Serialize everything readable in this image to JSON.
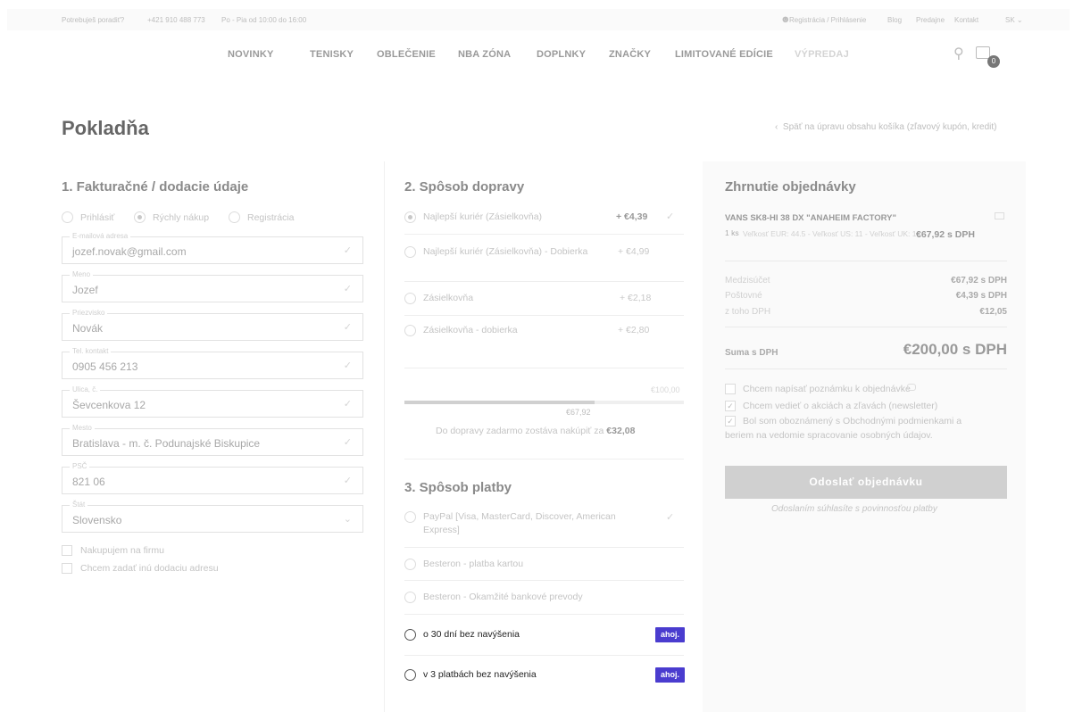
{
  "topbar": {
    "help": "Potrebuješ poradiť?",
    "phone": "+421 910 488 773",
    "hours": "Po - Pia od 10:00 do 16:00",
    "account": "Registrácia / Prihlásenie",
    "blog": "Blog",
    "stores": "Predajne",
    "contact": "Kontakt",
    "lang": "SK"
  },
  "nav": {
    "items": [
      "NOVINKY",
      "TENISKY",
      "OBLEČENIE",
      "NBA ZÓNA",
      "DOPLNKY",
      "ZNAČKY",
      "LIMITOVANÉ EDÍCIE",
      "VÝPREDAJ"
    ],
    "cart_count": "0"
  },
  "page": {
    "title": "Pokladňa",
    "back": "Späť na úpravu obsahu košíka (zľavový kupón, kredit)"
  },
  "billing": {
    "heading": "1. Fakturačné / dodacie údaje",
    "modes": [
      "Prihlásiť",
      "Rýchly nákup",
      "Registrácia"
    ],
    "fields": [
      {
        "label": "E-mailová adresa",
        "value": "jozef.novak@gmail.com"
      },
      {
        "label": "Meno",
        "value": "Jozef"
      },
      {
        "label": "Priezvisko",
        "value": "Novák"
      },
      {
        "label": "Tel. kontakt",
        "value": "0905 456 213"
      },
      {
        "label": "Ulica, č.",
        "value": "Ševcenkova 12"
      },
      {
        "label": "Mesto",
        "value": "Bratislava - m. č. Podunajské Biskupice"
      },
      {
        "label": "PSČ",
        "value": "821 06"
      },
      {
        "label": "Štát",
        "value": "Slovensko"
      }
    ],
    "company": "Nakupujem na firmu",
    "other_address": "Chcem zadať inú dodaciu adresu"
  },
  "shipping": {
    "heading": "2. Spôsob dopravy",
    "options": [
      {
        "name": "Najlepší kuriér (Zásielkovňa)",
        "price": "+ €4,39"
      },
      {
        "name": "Najlepší kuriér (Zásielkovňa) - Dobierka",
        "price": "+ €4,99"
      },
      {
        "name": "Zásielkovňa",
        "price": "+ €2,18"
      },
      {
        "name": "Zásielkovňa - dobierka",
        "price": "+ €2,80"
      }
    ],
    "progress_max": "€100,00",
    "progress_current": "€67,92",
    "progress_fraction": 0.68,
    "free_text": "Do dopravy zadarmo zostáva nakúpiť za",
    "free_remaining": "€32,08"
  },
  "payment": {
    "heading": "3. Spôsob platby",
    "options": [
      {
        "name": "PayPal [Visa, MasterCard, Discover, American Express]"
      },
      {
        "name": "Besteron - platba kartou"
      },
      {
        "name": "Besteron - Okamžité bankové prevody"
      },
      {
        "name": "o 30 dní bez navýšenia",
        "badge": "ahoj."
      },
      {
        "name": "v 3 platbách bez navýšenia",
        "badge": "ahoj."
      }
    ]
  },
  "summary": {
    "heading": "Zhrnutie objednávky",
    "product": "VANS SK8-HI 38 DX \"ANAHEIM FACTORY\"",
    "qty": "1 ks",
    "variant": "Veľkosť EUR: 44.5 - Veľkosť US: 11 - Veľkosť UK: 10",
    "product_price": "€67,92 s DPH",
    "subtotal_label": "Medzisúčet",
    "subtotal": "€67,92 s DPH",
    "postage_label": "Poštovné",
    "postage": "€4,39 s DPH",
    "vat_label": "z toho DPH",
    "vat": "€12,05",
    "total_label": "Suma s DPH",
    "total": "€200,00 s DPH",
    "note": "Chcem napísať poznámku k objednávke",
    "newsletter": "Chcem vedieť o akciách a zľavách (newsletter)",
    "terms_1": "Bol som oboznámený s Obchodnými podmienkami a",
    "terms_2": "beriem na vedomie spracovanie osobných údajov.",
    "submit": "Odoslať objednávku",
    "disclaimer": "Odoslaním súhlasíte s povinnosťou platby"
  }
}
